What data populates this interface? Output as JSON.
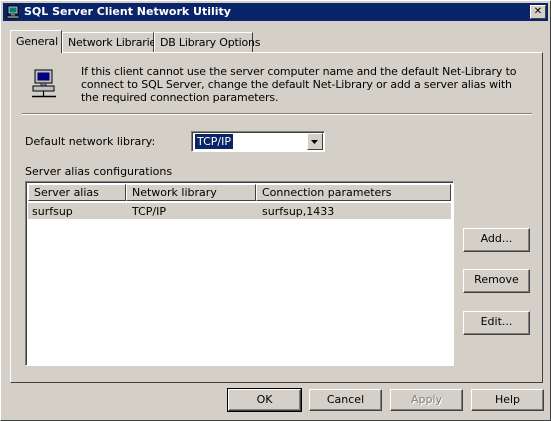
{
  "window": {
    "title": "SQL Server Client Network Utility",
    "close_glyph": "✕"
  },
  "tabs": [
    {
      "label": "General",
      "active": true
    },
    {
      "label": "Network Libraries",
      "active": false
    },
    {
      "label": "DB Library Options",
      "active": false
    }
  ],
  "general": {
    "info_icon": "network-computer-icon",
    "info_text": "If this client cannot use the server computer name and the default Net-Library to connect to SQL Server, change the default Net-Library or add a server alias with the required connection parameters.",
    "default_library_label": "Default network library:",
    "default_library_value": "TCP/IP",
    "alias_group_label": "Server alias configurations",
    "alias_table": {
      "columns": [
        "Server alias",
        "Network library",
        "Connection parameters"
      ],
      "rows": [
        {
          "alias": "surfsup",
          "library": "TCP/IP",
          "params": "surfsup,1433"
        }
      ]
    },
    "buttons": {
      "add": "Add...",
      "remove": "Remove",
      "edit": "Edit..."
    }
  },
  "footer": {
    "ok": "OK",
    "cancel": "Cancel",
    "apply": "Apply",
    "help": "Help"
  },
  "colors": {
    "titlebar": "#0a246a",
    "face": "#d4d0c8",
    "selection": "#0a246a"
  }
}
